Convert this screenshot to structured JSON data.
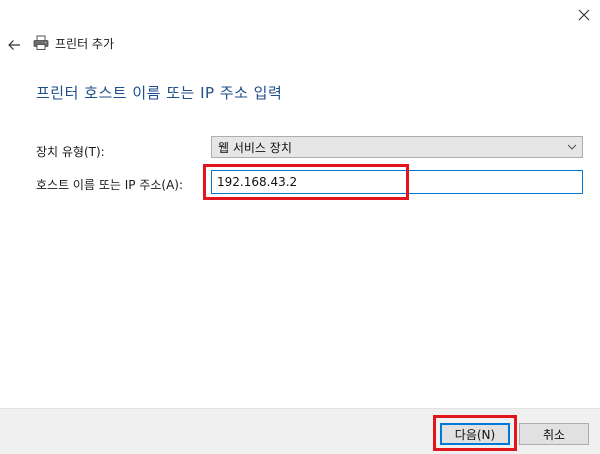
{
  "window": {
    "title": "프린터 추가",
    "close_icon": "close-icon",
    "back_icon": "back-arrow-icon",
    "printer_icon": "printer-icon"
  },
  "page": {
    "heading": "프린터 호스트 이름 또는 IP 주소 입력"
  },
  "form": {
    "device_type": {
      "label": "장치 유형(T):",
      "selected_value": "웹 서비스 장치"
    },
    "host": {
      "label": "호스트 이름 또는 IP 주소(A):",
      "value": "192.168.43.2"
    }
  },
  "footer": {
    "next_label": "다음(N)",
    "cancel_label": "취소"
  },
  "colors": {
    "heading": "#1f4e8c",
    "highlight": "#e2141c",
    "focus": "#0078d7",
    "footer_bg": "#f0f0f0"
  }
}
